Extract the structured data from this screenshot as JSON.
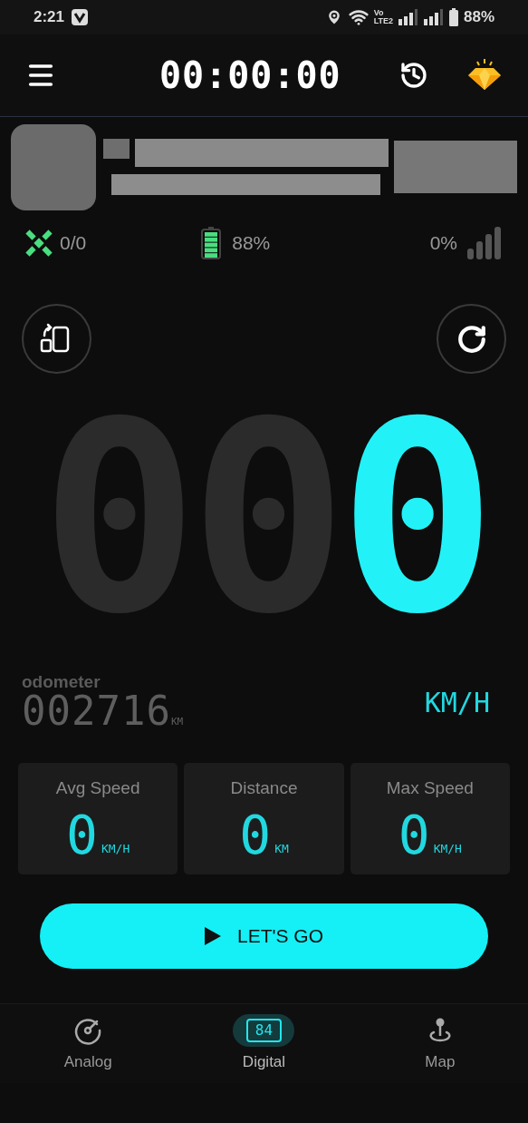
{
  "status_bar": {
    "time": "2:21",
    "network_top": "Vo",
    "network_bottom": "LTE2",
    "battery": "88%"
  },
  "header": {
    "timer": "00:00:00"
  },
  "gps_stats": {
    "satellites": "0/0",
    "battery": "88%",
    "signal": "0%"
  },
  "speed": {
    "digits": [
      {
        "char": "0",
        "lit": false
      },
      {
        "char": "0",
        "lit": false
      },
      {
        "char": "0",
        "lit": true
      }
    ],
    "unit": "KM/H"
  },
  "odometer": {
    "label": "odometer",
    "value": "002716",
    "unit": "KM"
  },
  "cards": [
    {
      "label": "Avg Speed",
      "value": "0",
      "unit": "KM/H"
    },
    {
      "label": "Distance",
      "value": "0",
      "unit": "KM"
    },
    {
      "label": "Max Speed",
      "value": "0",
      "unit": "KM/H"
    }
  ],
  "start_button": {
    "label": "LET'S GO"
  },
  "nav": [
    {
      "kind": "analog",
      "label": "Analog",
      "selected": false
    },
    {
      "kind": "digital",
      "label": "Digital",
      "icon_text": "84",
      "selected": true
    },
    {
      "kind": "map",
      "label": "Map",
      "selected": false
    }
  ]
}
